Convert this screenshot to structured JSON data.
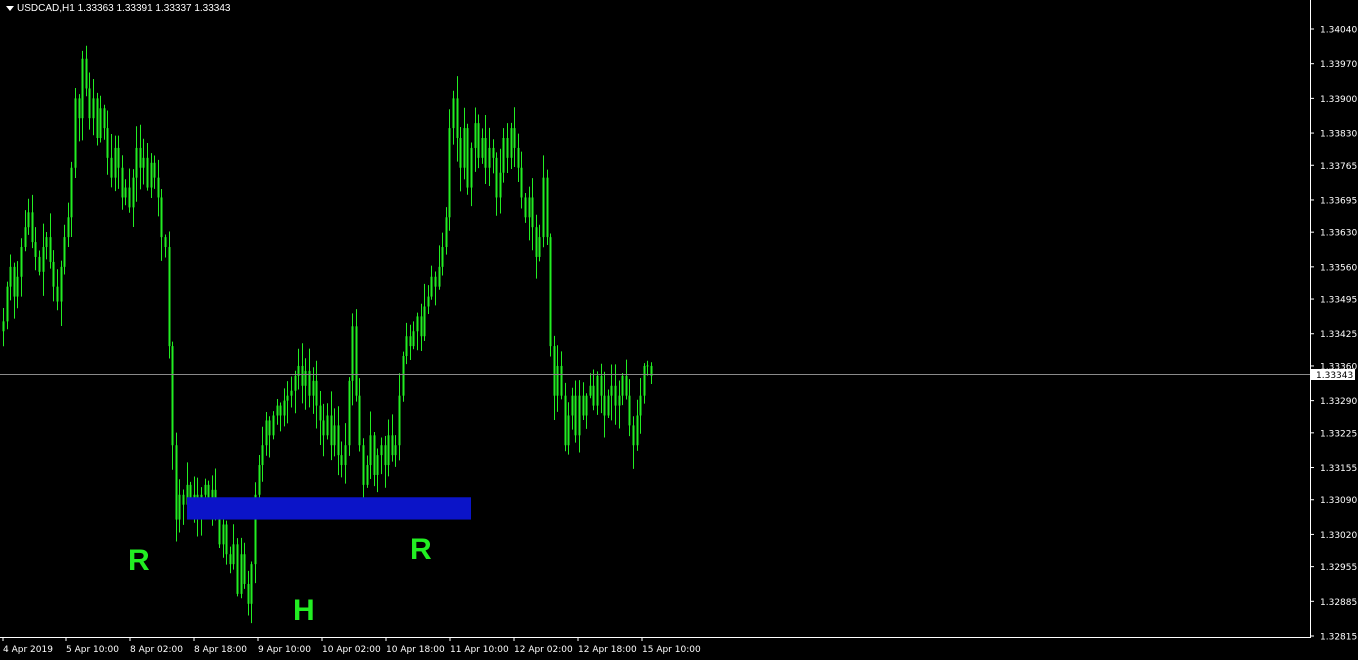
{
  "symbol": {
    "label": "USDCAD,H1  1.33363 1.33391 1.33337 1.33343"
  },
  "colors": {
    "background": "#000000",
    "candle": "#22ee22",
    "axis": "#ffffff",
    "zone": "#0b14c8",
    "annotation": "#22ee22",
    "price_line": "#8a8a8a"
  },
  "chart_data": {
    "type": "candlestick",
    "title": "USDCAD,H1",
    "ohlc_header": [
      "1.33363",
      "1.33391",
      "1.33337",
      "1.33343"
    ],
    "ylim": [
      1.328,
      1.3407
    ],
    "y_ticks": [
      "1.34040",
      "1.33970",
      "1.33900",
      "1.33830",
      "1.33765",
      "1.33695",
      "1.33630",
      "1.33560",
      "1.33495",
      "1.33425",
      "1.33360",
      "1.33290",
      "1.33225",
      "1.33155",
      "1.33090",
      "1.33020",
      "1.32955",
      "1.32885",
      "1.32815"
    ],
    "x_ticks": [
      "4 Apr 2019",
      "5 Apr 10:00",
      "8 Apr 02:00",
      "8 Apr 18:00",
      "9 Apr 10:00",
      "10 Apr 02:00",
      "10 Apr 18:00",
      "11 Apr 10:00",
      "12 Apr 02:00",
      "12 Apr 18:00",
      "15 Apr 10:00"
    ],
    "current_price": "1.33343",
    "support_zone": {
      "low": 1.3305,
      "high": 1.33095
    },
    "annotations": [
      {
        "text": "R",
        "near": "8 Apr 02:00"
      },
      {
        "text": "H",
        "near": "9 Apr 10:00"
      },
      {
        "text": "R",
        "near": "10 Apr 18:00"
      }
    ],
    "close_path": [
      1.3345,
      1.3352,
      1.3356,
      1.335,
      1.3354,
      1.336,
      1.3364,
      1.3367,
      1.3361,
      1.3358,
      1.3355,
      1.336,
      1.3362,
      1.3357,
      1.3352,
      1.3349,
      1.3356,
      1.3362,
      1.3366,
      1.3376,
      1.339,
      1.3386,
      1.3398,
      1.3392,
      1.3386,
      1.339,
      1.3382,
      1.3388,
      1.3384,
      1.3378,
      1.3374,
      1.338,
      1.3376,
      1.337,
      1.3372,
      1.3368,
      1.3374,
      1.338,
      1.3376,
      1.3378,
      1.3372,
      1.3377,
      1.3374,
      1.337,
      1.3362,
      1.336,
      1.334,
      1.332,
      1.3305,
      1.331,
      1.3308,
      1.3312,
      1.3308,
      1.331,
      1.3306,
      1.331,
      1.3312,
      1.3308,
      1.3311,
      1.3306,
      1.33,
      1.3304,
      1.3298,
      1.3296,
      1.33,
      1.329,
      1.3298,
      1.3292,
      1.3288,
      1.3296,
      1.331,
      1.3316,
      1.332,
      1.3325,
      1.3322,
      1.3326,
      1.3328,
      1.3326,
      1.3329,
      1.333,
      1.3331,
      1.3334,
      1.3336,
      1.3332,
      1.3335,
      1.333,
      1.3333,
      1.3328,
      1.3325,
      1.3322,
      1.3326,
      1.332,
      1.3324,
      1.3318,
      1.3316,
      1.332,
      1.3333,
      1.3344,
      1.333,
      1.332,
      1.3312,
      1.3316,
      1.3322,
      1.3314,
      1.3318,
      1.332,
      1.3316,
      1.3322,
      1.3318,
      1.332,
      1.333,
      1.3338,
      1.3342,
      1.334,
      1.3343,
      1.3346,
      1.3342,
      1.3348,
      1.335,
      1.3354,
      1.3352,
      1.3356,
      1.336,
      1.3366,
      1.3384,
      1.339,
      1.3382,
      1.3376,
      1.3384,
      1.3372,
      1.338,
      1.3385,
      1.3378,
      1.3382,
      1.3376,
      1.338,
      1.3378,
      1.337,
      1.3375,
      1.3382,
      1.3378,
      1.3384,
      1.338,
      1.3376,
      1.337,
      1.3366,
      1.337,
      1.3364,
      1.3358,
      1.3362,
      1.3374,
      1.3362,
      1.334,
      1.333,
      1.3336,
      1.333,
      1.332,
      1.3326,
      1.333,
      1.3322,
      1.333,
      1.3326,
      1.333,
      1.3332,
      1.3328,
      1.3334,
      1.333,
      1.3326,
      1.333,
      1.3332,
      1.3328,
      1.333,
      1.3334,
      1.333,
      1.3324,
      1.332,
      1.3326,
      1.333,
      1.3336,
      1.3336,
      1.3334
    ]
  }
}
